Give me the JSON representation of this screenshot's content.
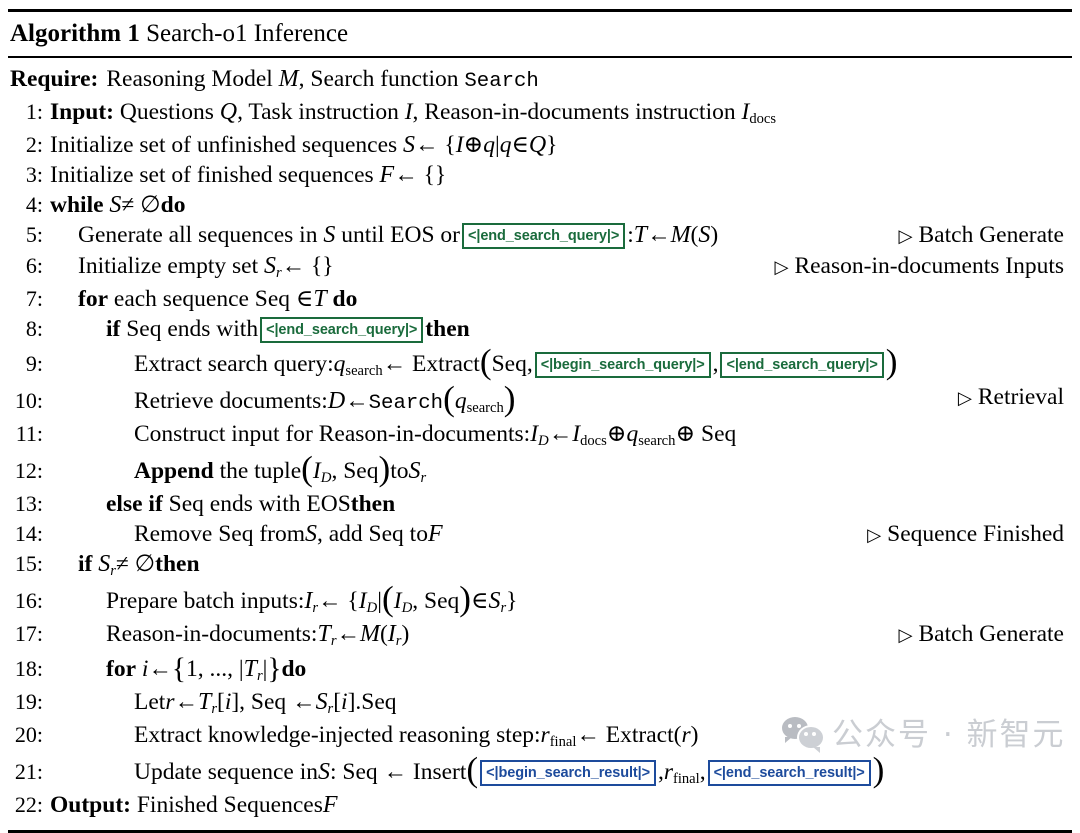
{
  "title": {
    "prefix": "Algorithm 1",
    "name": "Search-o1 Inference"
  },
  "require": {
    "label": "Require:",
    "text_1": "Reasoning Model",
    "sym_model": "M",
    "text_2": ", Search function",
    "func": "Search"
  },
  "tokens": {
    "begin_search_query": "<|begin_search_query|>",
    "end_search_query": "<|end_search_query|>",
    "begin_search_result": "<|begin_search_result|>",
    "end_search_result": "<|end_search_result|>"
  },
  "colors": {
    "query_token": "#1a6b3c",
    "result_token": "#1d4b9c",
    "text": "#000000",
    "watermark": "#cacdd2"
  },
  "comments": {
    "batch_generate": "Batch Generate",
    "reason_in_documents_inputs": "Reason-in-documents Inputs",
    "retrieval": "Retrieval",
    "sequence_finished": "Sequence Finished"
  },
  "lines": [
    {
      "num": "1:",
      "text": "Input: Questions Q, Task instruction I, Reason-in-documents instruction I_docs"
    },
    {
      "num": "2:",
      "text": "Initialize set of unfinished sequences S ← {I ⊕ q | q ∈ Q}"
    },
    {
      "num": "3:",
      "text": "Initialize set of finished sequences F ← {}"
    },
    {
      "num": "4:",
      "text": "while S ≠ ∅ do"
    },
    {
      "num": "5:",
      "text": "Generate all sequences in S until EOS or <|end_search_query|>: T ← M(S)",
      "comment": "Batch Generate"
    },
    {
      "num": "6:",
      "text": "Initialize empty set S_r ← {}",
      "comment": "Reason-in-documents Inputs"
    },
    {
      "num": "7:",
      "text": "for each sequence Seq ∈ T do"
    },
    {
      "num": "8:",
      "text": "if Seq ends with <|end_search_query|> then"
    },
    {
      "num": "9:",
      "text": "Extract search query: q_search ← Extract(Seq, <|begin_search_query|>, <|end_search_query|>)"
    },
    {
      "num": "10:",
      "text": "Retrieve documents: D ← Search(q_search)",
      "comment": "Retrieval"
    },
    {
      "num": "11:",
      "text": "Construct input for Reason-in-documents: I_D ← I_docs ⊕ q_search ⊕ Seq"
    },
    {
      "num": "12:",
      "text": "Append the tuple (I_D, Seq) to S_r"
    },
    {
      "num": "13:",
      "text": "else if Seq ends with EOS then"
    },
    {
      "num": "14:",
      "text": "Remove Seq from S, add Seq to F",
      "comment": "Sequence Finished"
    },
    {
      "num": "15:",
      "text": "if S_r ≠ ∅ then"
    },
    {
      "num": "16:",
      "text": "Prepare batch inputs: I_r ← {I_D | (I_D, Seq) ∈ S_r}"
    },
    {
      "num": "17:",
      "text": "Reason-in-documents: T_r ← M(I_r)",
      "comment": "Batch Generate"
    },
    {
      "num": "18:",
      "text": "for i ← {1, ..., |T_r|} do"
    },
    {
      "num": "19:",
      "text": "Let r ← T_r[i], Seq ← S_r[i].Seq"
    },
    {
      "num": "20:",
      "text": "Extract knowledge-injected reasoning step: r_final ← Extract(r)"
    },
    {
      "num": "21:",
      "text": "Update sequence in S: Seq ← Insert (<|begin_search_result|>, r_final, <|end_search_result|>)"
    },
    {
      "num": "22:",
      "text": "Output: Finished Sequences F"
    }
  ],
  "watermark": {
    "text": "公众号 · 新智元"
  }
}
